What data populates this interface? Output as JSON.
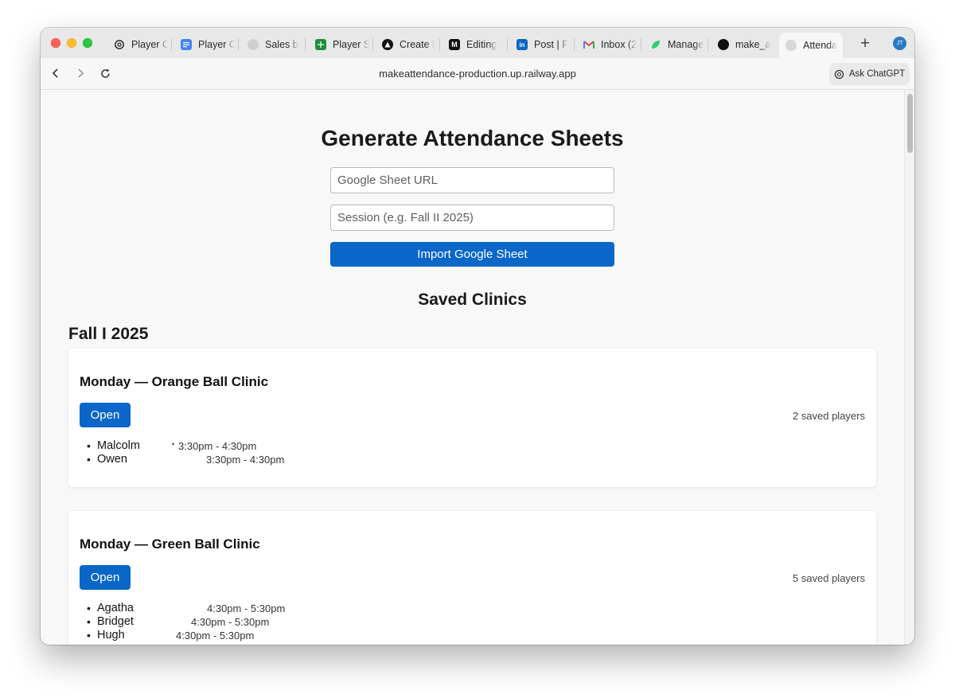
{
  "browser": {
    "tabs": [
      {
        "title": "Player C",
        "icon": "chatgpt-icon"
      },
      {
        "title": "Player C",
        "icon": "google-docs-icon"
      },
      {
        "title": "Sales b",
        "icon": "globe-icon"
      },
      {
        "title": "Player S",
        "icon": "google-sheets-icon"
      },
      {
        "title": "Create l",
        "icon": "triangle-logo-icon"
      },
      {
        "title": "Editing",
        "icon": "medium-icon"
      },
      {
        "title": "Post | F",
        "icon": "linkedin-icon"
      },
      {
        "title": "Inbox (2",
        "icon": "gmail-icon"
      },
      {
        "title": "Manage",
        "icon": "leaf-app-icon"
      },
      {
        "title": "make_a",
        "icon": "dark-circle-icon"
      },
      {
        "title": "Attenda",
        "icon": "globe-icon"
      }
    ],
    "new_tab": "+",
    "profile_initials": "JT",
    "url": "makeattendance-production.up.railway.app",
    "ask_chatgpt": "Ask ChatGPT"
  },
  "page": {
    "title": "Generate Attendance Sheets",
    "sheet_url_placeholder": "Google Sheet URL",
    "session_placeholder": "Session (e.g. Fall II 2025)",
    "import_button": "Import Google Sheet",
    "saved_heading": "Saved Clinics",
    "session_name": "Fall I 2025",
    "clinics": [
      {
        "title": "Monday — Orange Ball Clinic",
        "open_label": "Open",
        "count_label": "2 saved players",
        "players": [
          {
            "name": "Malcolm",
            "time": "3:30pm - 4:30pm"
          },
          {
            "name": "Owen",
            "time": "3:30pm - 4:30pm"
          }
        ]
      },
      {
        "title": "Monday — Green Ball Clinic",
        "open_label": "Open",
        "count_label": "5 saved players",
        "players": [
          {
            "name": "Agatha",
            "time": "4:30pm - 5:30pm"
          },
          {
            "name": "Bridget",
            "time": "4:30pm - 5:30pm"
          },
          {
            "name": "Hugh",
            "time": "4:30pm - 5:30pm"
          }
        ]
      }
    ]
  },
  "colors": {
    "primary": "#0a66c8",
    "tab_bar": "#e8e8e8",
    "page_bg": "#f8f8f8"
  }
}
